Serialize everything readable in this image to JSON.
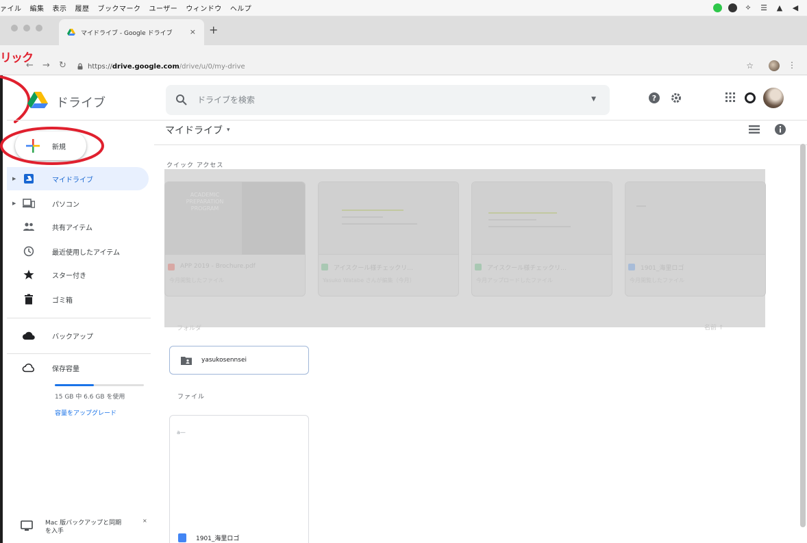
{
  "menubar": {
    "items": [
      "ァイル",
      "編集",
      "表示",
      "履歴",
      "ブックマーク",
      "ユーザー",
      "ウィンドウ",
      "ヘルプ"
    ]
  },
  "browser": {
    "tab_title": "マイドライブ - Google ドライブ",
    "tab_close": "×",
    "new_tab": "+",
    "url_scheme": "https://",
    "url_host": "drive.google.com",
    "url_path": "/drive/u/0/my-drive"
  },
  "annotation": {
    "label": "リック",
    "color": "#e0202e"
  },
  "drive": {
    "logo_text": "ドライブ",
    "search_placeholder": "ドライブを検索"
  },
  "leftnav": {
    "new_button": "新規",
    "items": [
      {
        "label": "マイドライブ",
        "icon": "my-drive-icon"
      },
      {
        "label": "パソコン",
        "icon": "computer-icon"
      },
      {
        "label": "共有アイテム",
        "icon": "shared-icon"
      },
      {
        "label": "最近使用したアイテム",
        "icon": "clock-icon"
      },
      {
        "label": "スター付き",
        "icon": "star-icon"
      },
      {
        "label": "ゴミ箱",
        "icon": "trash-icon"
      },
      {
        "label": "バックアップ",
        "icon": "cloud-icon"
      },
      {
        "label": "保存容量",
        "icon": "cloud-outline-icon"
      }
    ],
    "storage_text": "15 GB 中 6.6 GB を使用",
    "storage_fraction": 0.44,
    "upgrade_link": "容量をアップグレード",
    "backup_promo_line1": "Mac 版バックアップと同期",
    "backup_promo_line2": "を入手",
    "promo_close": "×"
  },
  "main": {
    "title": "マイドライブ",
    "title_caret": "▾",
    "quick_access_label": "クイック アクセス",
    "quick_access": [
      {
        "name": "APP 2019 - Brochure.pdf",
        "sub": "今月開覧したファイル",
        "thumb_lines": [
          "ACADEMIC",
          "PREPARATION",
          "PROGRAM"
        ],
        "icon_color": "#ea4335"
      },
      {
        "name": "アイスクール様チェックリ...",
        "sub": "Yasuko Watabe さんが編集（今月）",
        "icon_color": "#0f9d58"
      },
      {
        "name": "アイスクール様チェックリ...",
        "sub": "今月アップロードしたファイル",
        "icon_color": "#0f9d58"
      },
      {
        "name": "1901_海里ロゴ",
        "sub": "今月開覧したファイル",
        "icon_color": "#4285f4"
      }
    ],
    "overlay_folder_label": "フォルダ",
    "overlay_sort": "名前  ↑",
    "folder_name": "yasukosennsei",
    "files_label": "ファイル",
    "file_preview": "a—",
    "file_name": "1901_海里ロゴ"
  }
}
